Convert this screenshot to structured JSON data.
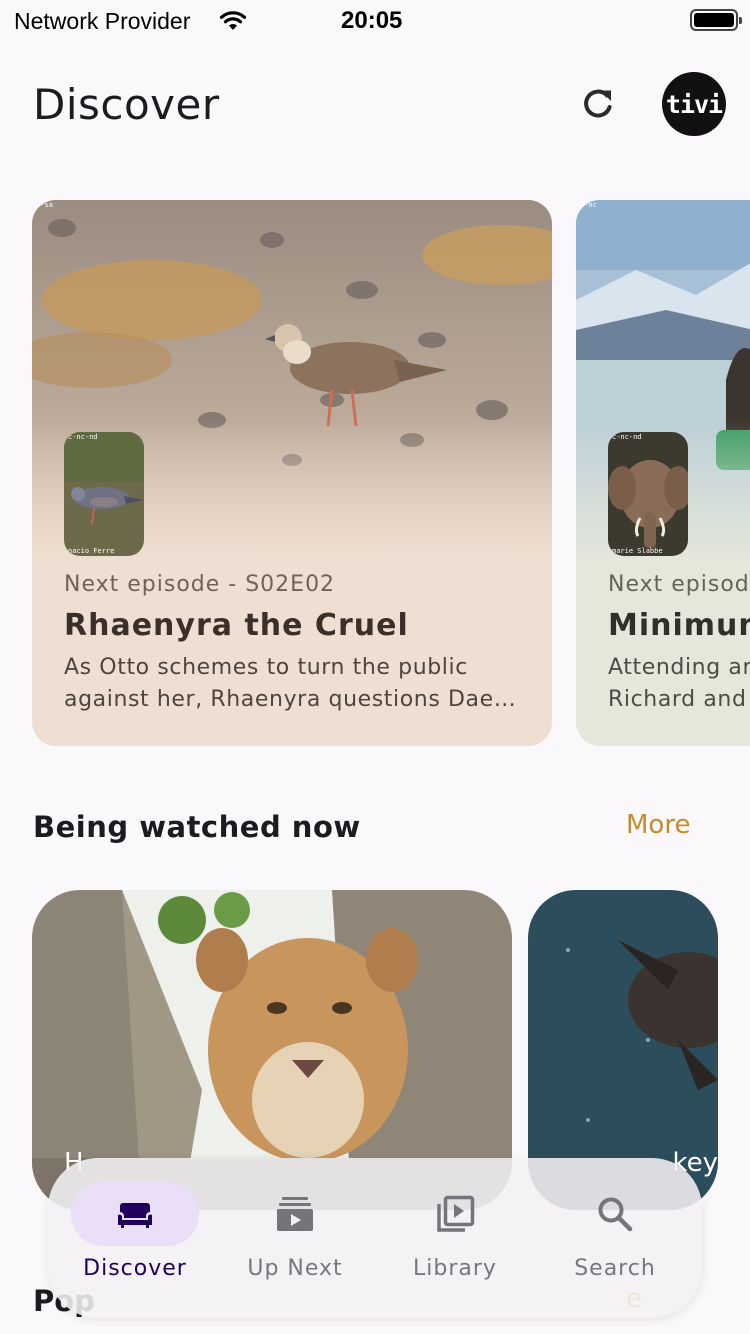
{
  "status_bar": {
    "carrier": "Network Provider",
    "time": "20:05"
  },
  "header": {
    "title": "Discover",
    "avatar_text": "tivi"
  },
  "featured": [
    {
      "meta": "Next episode - S02E02",
      "title": "Rhaenyra the Cruel",
      "description_line1": "As Otto schemes to turn the public",
      "description_line2": "against her, Rhaenyra questions Dae…",
      "license_tag": "c-sa",
      "poster_tag_top": "c-nc-nd",
      "poster_tag_bottom": "nacio Ferre",
      "color": "#efdfd2"
    },
    {
      "meta": "Next episod",
      "title": "Minimum",
      "description_line1": "Attending ar",
      "description_line2": "Richard and",
      "license_tag": "c-nc",
      "poster_tag_top": "c-nc-nd",
      "poster_tag_bottom": "marie Slabbe",
      "color": "#e4e7da"
    }
  ],
  "being_watched": {
    "title": "Being watched now",
    "more_label": "More",
    "tiles": [
      {
        "label": "H"
      },
      {
        "label": "key"
      }
    ]
  },
  "popular": {
    "title": "Pop",
    "more_label": "e"
  },
  "bottom_nav": {
    "items": [
      {
        "label": "Discover",
        "icon": "couch-icon",
        "active": true
      },
      {
        "label": "Up Next",
        "icon": "video-stack-icon",
        "active": false
      },
      {
        "label": "Library",
        "icon": "video-library-icon",
        "active": false
      },
      {
        "label": "Search",
        "icon": "search-icon",
        "active": false
      }
    ]
  },
  "colors": {
    "background": "#fbf8fb",
    "accent": "#c68b2d",
    "nav_active_indicator": "#eadff7",
    "nav_active_label": "#21005d"
  }
}
